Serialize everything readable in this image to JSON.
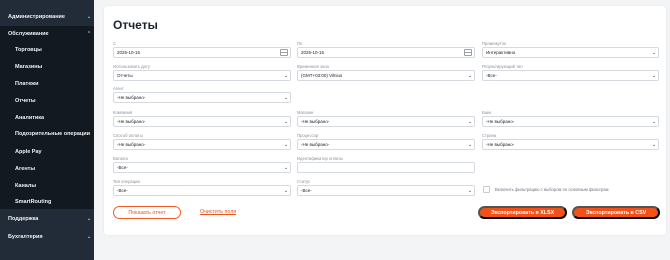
{
  "sidebar": {
    "items": [
      {
        "label": "Администрирование",
        "chevron": "⌄"
      },
      {
        "label": "Обслуживание",
        "chevron": "⌃"
      },
      {
        "label": "Торговцы"
      },
      {
        "label": "Магазины"
      },
      {
        "label": "Платежи"
      },
      {
        "label": "Отчеты"
      },
      {
        "label": "Аналитика"
      },
      {
        "label": "Подозрительные операции"
      },
      {
        "label": "Apple Pay"
      },
      {
        "label": "Агенты"
      },
      {
        "label": "Каналы"
      },
      {
        "label": "SmartRouting"
      },
      {
        "label": "Поддержка",
        "chevron": "⌄"
      },
      {
        "label": "Бухгалтерия",
        "chevron": "⌄"
      }
    ]
  },
  "page": {
    "title": "Отчеты"
  },
  "form": {
    "from": {
      "label": "С",
      "value": "2025-10-15"
    },
    "to": {
      "label": "По",
      "value": "2025-10-15"
    },
    "period": {
      "label": "Промежуток",
      "value": "Интерактивно"
    },
    "use_date": {
      "label": "Использовать дату",
      "value": "Отчеты"
    },
    "timezone": {
      "label": "Временная зона",
      "value": "(GMT+03:00) Vilnius"
    },
    "result_type": {
      "label": "Результирующий тип",
      "value": "-Все-"
    },
    "agent": {
      "label": "Агент",
      "value": "-Не выбрано-"
    },
    "company": {
      "label": "Компания",
      "value": "-Не выбрано-"
    },
    "shop": {
      "label": "Магазин",
      "value": "-Не выбрано-"
    },
    "bank": {
      "label": "Банк",
      "value": "-Не выбрано-"
    },
    "payment_method": {
      "label": "Способ оплаты",
      "value": "-Не выбрано-"
    },
    "processor": {
      "label": "Процессор",
      "value": "-Не выбрано-"
    },
    "country": {
      "label": "Страна",
      "value": "-Не выбрано-"
    },
    "currency": {
      "label": "Валюта",
      "value": "-Все-"
    },
    "payment_id": {
      "label": "Идентификатор оплаты",
      "value": ""
    },
    "operation_type": {
      "label": "Тип операции",
      "value": "-Все-"
    },
    "status": {
      "label": "Статус",
      "value": "-Все-"
    },
    "checkbox_label": "Включить фильтрацию с выбором по основным фильтрам"
  },
  "actions": {
    "show_report": "Показать отчет",
    "clear": "Очистить поля",
    "export_xlsx": "Экспортировать в XLSX",
    "export_csv": "Экспортировать в CSV"
  },
  "icons": {
    "select": "chevron-down-icon",
    "date": "calendar-icon"
  },
  "colors": {
    "sidebar": "#222c38",
    "accent": "#f2521a"
  }
}
